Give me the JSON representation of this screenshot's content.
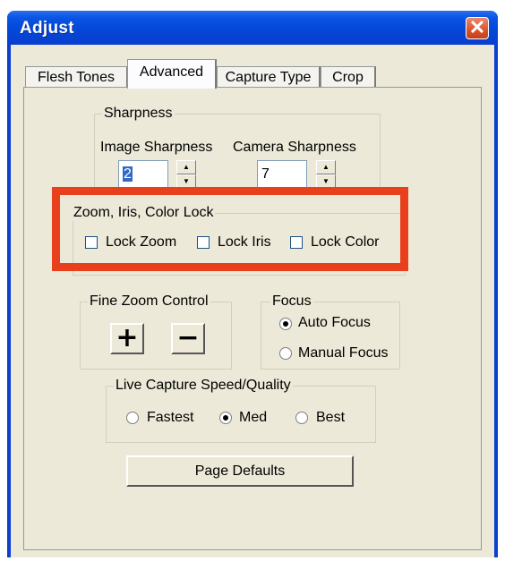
{
  "window": {
    "title": "Adjust",
    "close_glyph": "✕",
    "title_gradient": "#0a55e4",
    "close_color": "#d9542c"
  },
  "tabs": [
    {
      "label": "Flesh Tones",
      "active": false
    },
    {
      "label": "Advanced",
      "active": true
    },
    {
      "label": "Capture Type",
      "active": false
    },
    {
      "label": "Crop",
      "active": false
    }
  ],
  "sharpness": {
    "group_label": "Sharpness",
    "image_label": "Image Sharpness",
    "image_value": "2",
    "camera_label": "Camera Sharpness",
    "camera_value": "7",
    "spin_up_icon": "▲",
    "spin_down_icon": "▼"
  },
  "lock": {
    "group_label": "Zoom, Iris, Color Lock",
    "zoom_label": "Lock Zoom",
    "iris_label": "Lock Iris",
    "color_label": "Lock Color",
    "zoom_checked": false,
    "iris_checked": false,
    "color_checked": false,
    "highlight_color": "#e8401c"
  },
  "fine_zoom": {
    "group_label": "Fine Zoom Control",
    "plus_label": "+",
    "minus_label": "−"
  },
  "focus": {
    "group_label": "Focus",
    "auto_label": "Auto Focus",
    "manual_label": "Manual Focus",
    "selected": "Auto Focus"
  },
  "live_capture": {
    "group_label": "Live Capture Speed/Quality",
    "options": [
      "Fastest",
      "Med",
      "Best"
    ],
    "selected": "Med"
  },
  "page_defaults_label": "Page Defaults"
}
